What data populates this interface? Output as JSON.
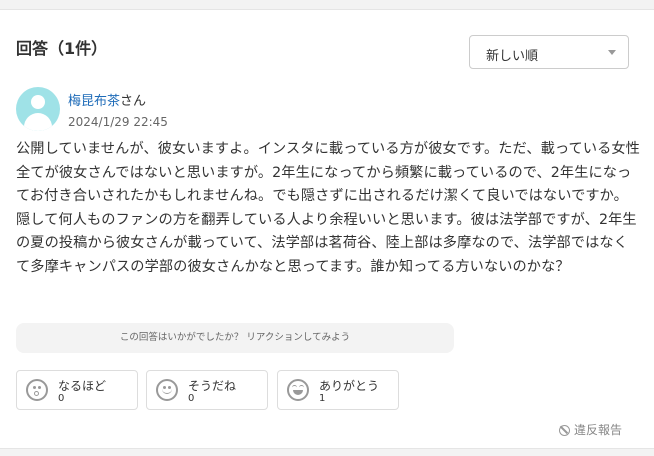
{
  "answers_header": {
    "title": "回答（1件）"
  },
  "sort": {
    "selected": "新しい順"
  },
  "answer": {
    "author_name": "梅昆布茶",
    "author_suffix": "さん",
    "date": "2024/1/29 22:45",
    "text": "公開していませんが、彼女いますよ。インスタに載っている方が彼女です。ただ、載っている女性全てが彼女さんではないと思いますが。2年生になってから頻繁に載っているので、2年生になってお付き合いされたかもしれませんね。でも隠さずに出されるだけ潔くて良いではないですか。隠して何人ものファンの方を翻弄している人より余程いいと思います。彼は法学部ですが、2年生の夏の投稿から彼女さんが載っていて、法学部は茗荷谷、陸上部は多摩なので、法学部ではなくて多摩キャンパスの学部の彼女さんかなと思ってます。誰か知ってる方いないのかな？"
  },
  "reaction_prompt": "この回答はいかがでしたか？ リアクションしてみよう",
  "reactions": [
    {
      "icon": "surprised-face-icon",
      "label": "なるほど",
      "count": "0"
    },
    {
      "icon": "smile-face-icon",
      "label": "そうだね",
      "count": "0"
    },
    {
      "icon": "happy-face-icon",
      "label": "ありがとう",
      "count": "1"
    }
  ],
  "report": {
    "label": "違反報告",
    "icon": "prohibited-icon"
  }
}
